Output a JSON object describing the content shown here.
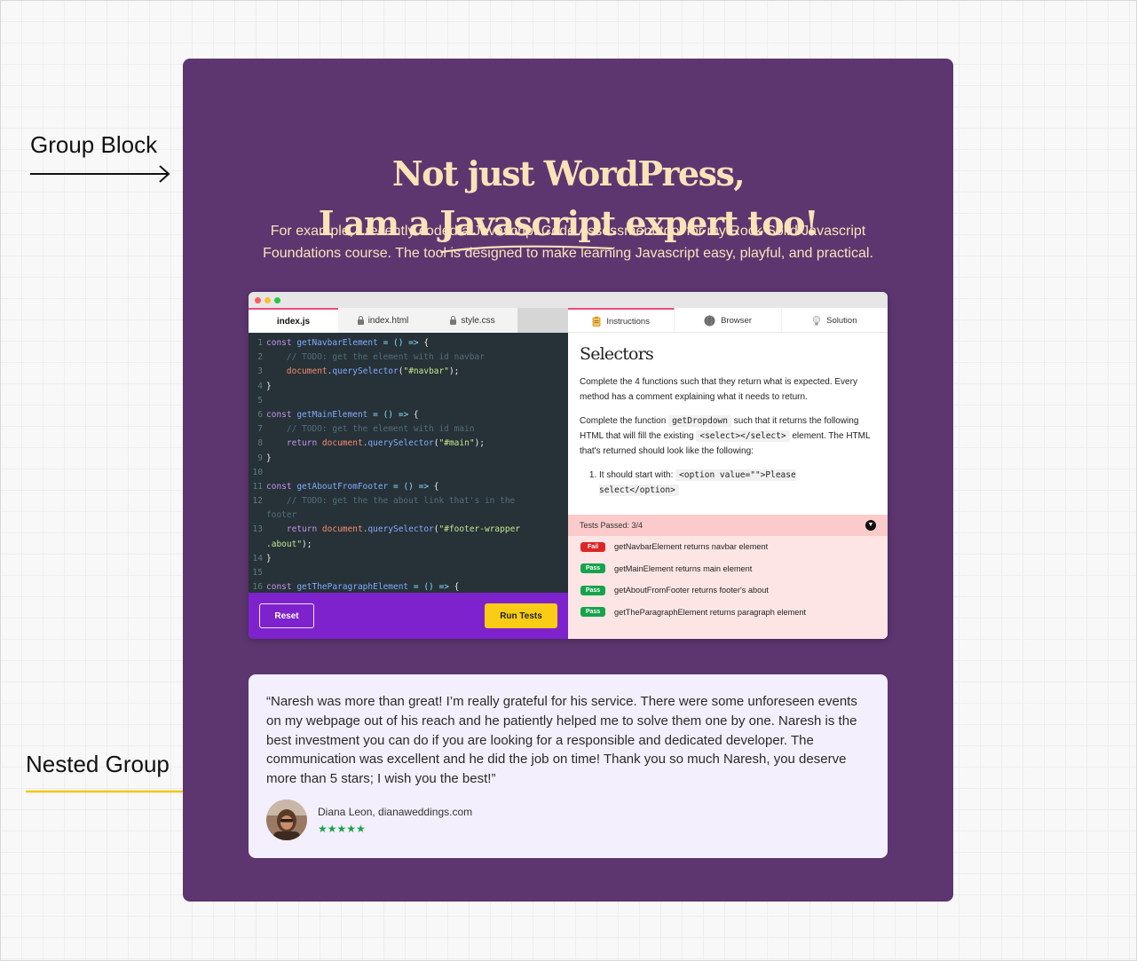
{
  "annotations": {
    "group_block": "Group Block",
    "nested_group": "Nested Group",
    "colors": {
      "group_arrow": "#111111",
      "nested_arrow": "#f5c518"
    }
  },
  "hero": {
    "title_line1": "Not just WordPress,",
    "title_line2_prefix": "I am a",
    "title_line2_highlight": "Javascript",
    "title_line2_suffix": "expert too!",
    "intro": "For example, I recently coded a Javascript Code Assessment tool for my Rock Solid Javascript Foundations course. The tool is designed to make learning Javascript easy, playful, and practical.",
    "colors": {
      "background": "#5d3670",
      "accent": "#fbe3b8"
    }
  },
  "tool": {
    "editor_tabs": [
      {
        "label": "index.js",
        "active": true,
        "locked": false
      },
      {
        "label": "index.html",
        "active": false,
        "locked": true
      },
      {
        "label": "style.css",
        "active": false,
        "locked": true
      }
    ],
    "code_lines": [
      {
        "n": "1",
        "tokens": [
          [
            "kw2",
            "const "
          ],
          [
            "fn",
            "getNavbarElement"
          ],
          [
            "op",
            " = () => "
          ],
          [
            "",
            "{"
          ]
        ]
      },
      {
        "n": "2",
        "tokens": [
          [
            "cm",
            "    // TODO: get the element with id navbar"
          ]
        ]
      },
      {
        "n": "3",
        "tokens": [
          [
            "obj",
            "    document"
          ],
          [
            "",
            ""
          ],
          [
            "op",
            "."
          ],
          [
            "fn",
            "querySelector"
          ],
          [
            "",
            "("
          ],
          [
            "str",
            "\"#navbar\""
          ],
          [
            "",
            ");"
          ]
        ]
      },
      {
        "n": "4",
        "tokens": [
          [
            "",
            "}"
          ]
        ]
      },
      {
        "n": "5",
        "tokens": []
      },
      {
        "n": "6",
        "tokens": [
          [
            "kw2",
            "const "
          ],
          [
            "fn",
            "getMainElement"
          ],
          [
            "op",
            " = () => "
          ],
          [
            "",
            "{"
          ]
        ]
      },
      {
        "n": "7",
        "tokens": [
          [
            "cm",
            "    // TODO: get the element with id main"
          ]
        ]
      },
      {
        "n": "8",
        "tokens": [
          [
            "kw2",
            "    return "
          ],
          [
            "obj",
            "document"
          ],
          [
            "op",
            "."
          ],
          [
            "fn",
            "querySelector"
          ],
          [
            "",
            "("
          ],
          [
            "str",
            "\"#main\""
          ],
          [
            "",
            ");"
          ]
        ]
      },
      {
        "n": "9",
        "tokens": [
          [
            "",
            "}"
          ]
        ]
      },
      {
        "n": "10",
        "tokens": []
      },
      {
        "n": "11",
        "tokens": [
          [
            "kw2",
            "const "
          ],
          [
            "fn",
            "getAboutFromFooter"
          ],
          [
            "op",
            " = () => "
          ],
          [
            "",
            "{"
          ]
        ]
      },
      {
        "n": "12",
        "tokens": [
          [
            "cm",
            "    // TODO: get the the about link that's in the"
          ]
        ]
      },
      {
        "n": "",
        "tokens": [
          [
            "cm",
            "footer"
          ]
        ]
      },
      {
        "n": "13",
        "tokens": [
          [
            "kw2",
            "    return "
          ],
          [
            "obj",
            "document"
          ],
          [
            "op",
            "."
          ],
          [
            "fn",
            "querySelector"
          ],
          [
            "",
            "("
          ],
          [
            "str",
            "\"#footer-wrapper"
          ]
        ]
      },
      {
        "n": "",
        "tokens": [
          [
            "str",
            ".about\""
          ],
          [
            "",
            ");"
          ]
        ]
      },
      {
        "n": "14",
        "tokens": [
          [
            "",
            "}"
          ]
        ]
      },
      {
        "n": "15",
        "tokens": []
      },
      {
        "n": "16",
        "tokens": [
          [
            "kw2",
            "const "
          ],
          [
            "fn",
            "getTheParagraphElement"
          ],
          [
            "op",
            " = () => "
          ],
          [
            "",
            "{"
          ]
        ]
      }
    ],
    "reset_label": "Reset",
    "run_label": "Run Tests",
    "panel_tabs": [
      {
        "label": "Instructions",
        "icon": "clipboard-icon",
        "active": true
      },
      {
        "label": "Browser",
        "icon": "globe-icon",
        "active": false
      },
      {
        "label": "Solution",
        "icon": "lightbulb-icon",
        "active": false
      }
    ],
    "instructions": {
      "title": "Selectors",
      "para1": "Complete the 4 functions such that they return what is expected. Every method has a comment explaining what it needs to return.",
      "para2_a": "Complete the function",
      "para2_code1": "getDropdown",
      "para2_b": "such that it returns the following HTML that will fill the existing",
      "para2_code2": "<select></select>",
      "para2_c": "element. The HTML that's returned should look like the following:",
      "list_item1_a": "It should start with:",
      "list_item1_code": "<option value=\"\">Please select</option>"
    },
    "tests": {
      "header": "Tests Passed: 3/4",
      "items": [
        {
          "status": "Fail",
          "label": "getNavbarElement returns navbar element"
        },
        {
          "status": "Pass",
          "label": "getMainElement returns main element"
        },
        {
          "status": "Pass",
          "label": "getAboutFromFooter returns footer's about"
        },
        {
          "status": "Pass",
          "label": "getTheParagraphElement returns paragraph element"
        }
      ]
    }
  },
  "testimonial": {
    "quote": "“Naresh was more than great! I’m really grateful for his service. There were some unforeseen events on my webpage out of his reach and he patiently helped me to solve them one by one. Naresh is the best investment you can do if you are looking for a responsible and dedicated developer. The communication was excellent and he did the job on time! Thank you so much Naresh, you deserve more than 5 stars; I wish you the best!”",
    "author": "Diana Leon, dianaweddings.com",
    "rating": 5,
    "stars": "★★★★★"
  }
}
